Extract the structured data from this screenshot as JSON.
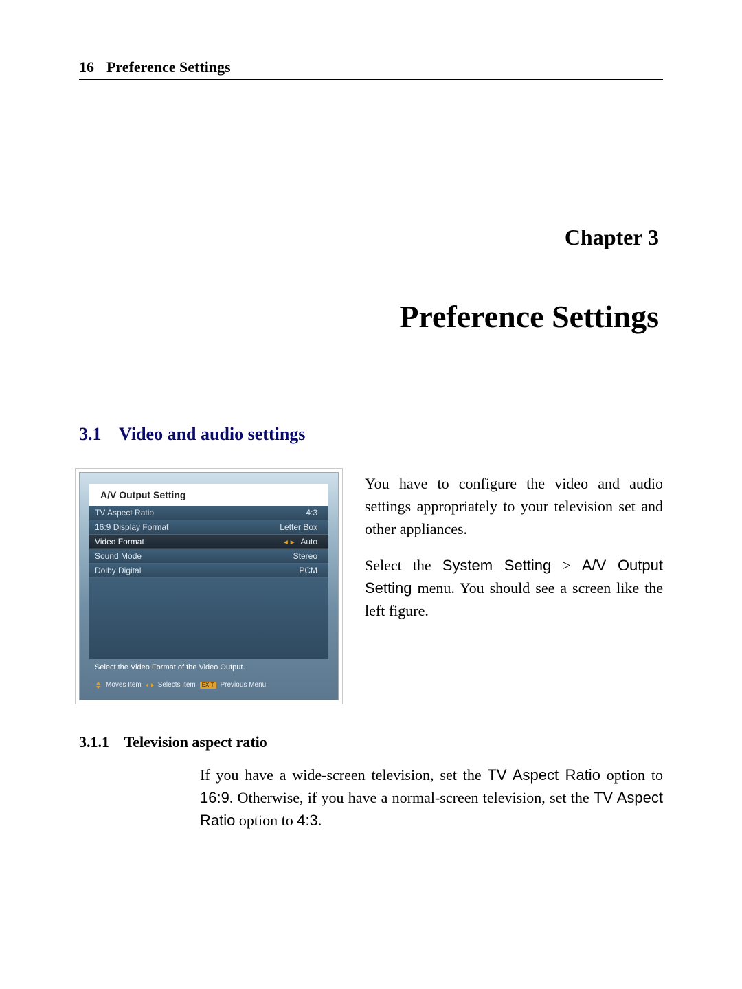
{
  "header": {
    "page_number": "16",
    "running_title": "Preference Settings"
  },
  "chapter": {
    "label": "Chapter 3",
    "title": "Preference Settings"
  },
  "section": {
    "number": "3.1",
    "title": "Video and audio settings"
  },
  "figure": {
    "panel_title": "A/V Output Setting",
    "rows": [
      {
        "label": "TV Aspect Ratio",
        "value": "4:3",
        "selected": false
      },
      {
        "label": "16:9 Display Format",
        "value": "Letter Box",
        "selected": false
      },
      {
        "label": "Video Format",
        "value": "Auto",
        "selected": true
      },
      {
        "label": "Sound Mode",
        "value": "Stereo",
        "selected": false
      },
      {
        "label": "Dolby Digital",
        "value": "PCM",
        "selected": false
      }
    ],
    "hint": "Select the Video Format of the Video Output.",
    "legend": {
      "moves": "Moves Item",
      "selects": "Selects Item",
      "exit_key": "EXIT",
      "prev": "Previous Menu"
    }
  },
  "right_paras": {
    "p1": "You have to configure the video and audio settings appropriately to your television set and other appliances.",
    "p2a": "Select the ",
    "p2b_menu1": "System Setting",
    "p2b_gt": " > ",
    "p2b_menu2": "A/V Output Setting",
    "p2c": " menu. You should see a screen like the left figure."
  },
  "subsection": {
    "number": "3.1.1",
    "title": "Television aspect ratio",
    "body_a": "If you have a wide-screen television, set the ",
    "body_opt": "TV Aspect Ratio",
    "body_b": " option to ",
    "body_val1": "16:9",
    "body_c": ". Otherwise, if you have a normal-screen television, set the ",
    "body_opt2": "TV Aspect Ratio",
    "body_d": " option to ",
    "body_val2": "4:3",
    "body_e": "."
  }
}
